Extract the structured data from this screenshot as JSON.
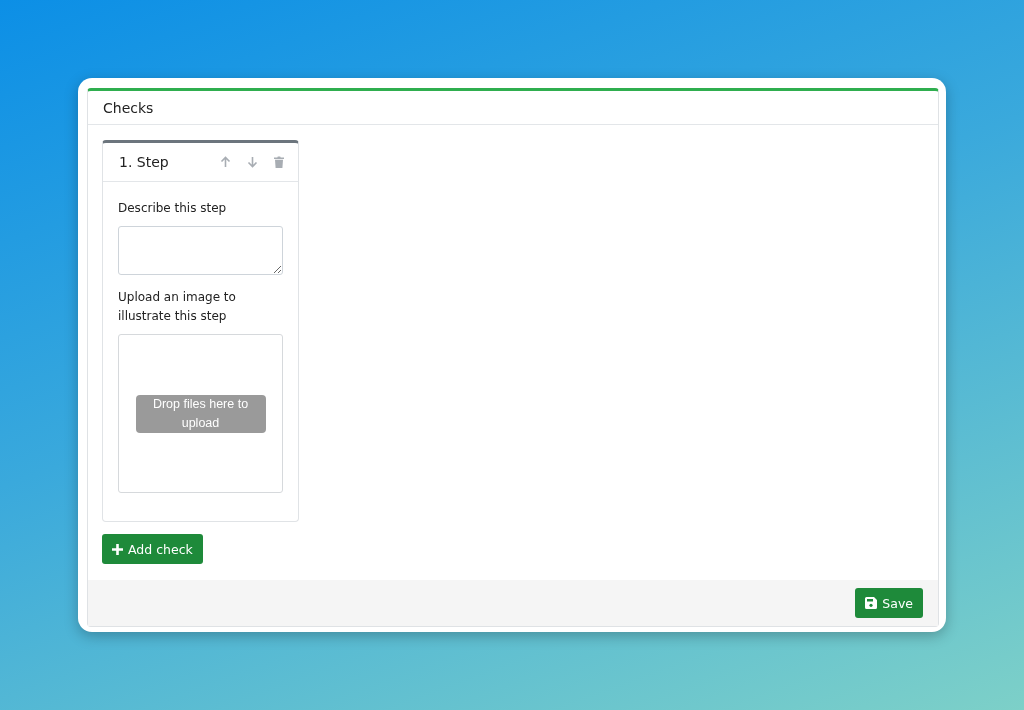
{
  "panel": {
    "title": "Checks"
  },
  "steps": [
    {
      "title": "1. Step",
      "describe_label": "Describe this step",
      "upload_label": "Upload an image to illustrate this step",
      "drop_text": "Drop files here to upload"
    }
  ],
  "add_button": "Add check",
  "save_button": "Save"
}
